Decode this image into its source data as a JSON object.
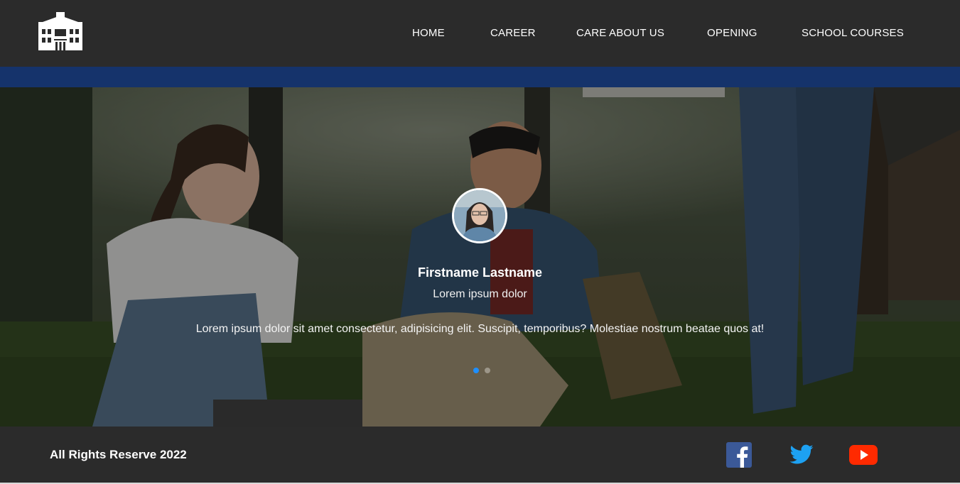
{
  "nav": {
    "logo_icon": "school-building-icon",
    "links": [
      "HOME",
      "CAREER",
      "CARE ABOUT US",
      "OPENING",
      "SCHOOL COURSES"
    ]
  },
  "testimonial": {
    "name": "Firstname Lastname",
    "role": "Lorem ipsum dolor",
    "text": "Lorem ipsum dolor sit amet consectetur, adipisicing elit. Suscipit, temporibus? Molestiae nostrum beatae quos at!",
    "active_slide": 1,
    "slide_count": 2
  },
  "footer": {
    "copyright": "All Rights Reserve 2022",
    "social_icons": [
      "facebook-icon",
      "twitter-icon",
      "youtube-icon"
    ]
  },
  "colors": {
    "navbar_bg": "#2b2b2b",
    "accent_band": "#15336b",
    "active_dot": "#1e8fff",
    "facebook": "#3b5998",
    "twitter": "#1da1f2",
    "youtube": "#ff0000"
  }
}
